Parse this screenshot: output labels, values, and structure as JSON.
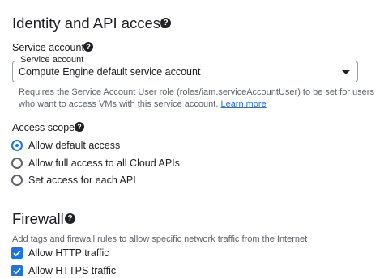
{
  "identity": {
    "title": "Identity and API access",
    "help_glyph": "?",
    "service_accounts": {
      "heading": "Service accounts",
      "help_glyph": "?",
      "select_legend": "Service account",
      "select_value": "Compute Engine default service account",
      "hint_text": "Requires the Service Account User role (roles/iam.serviceAccountUser) to be set for users who want to access VMs with this service account.",
      "learn_more": "Learn more"
    },
    "access_scopes": {
      "heading": "Access scopes",
      "help_glyph": "?",
      "options": [
        {
          "label": "Allow default access",
          "selected": true
        },
        {
          "label": "Allow full access to all Cloud APIs",
          "selected": false
        },
        {
          "label": "Set access for each API",
          "selected": false
        }
      ]
    }
  },
  "firewall": {
    "title": "Firewall",
    "help_glyph": "?",
    "hint_text": "Add tags and firewall rules to allow specific network traffic from the Internet",
    "checkboxes": [
      {
        "label": "Allow HTTP traffic",
        "checked": true
      },
      {
        "label": "Allow HTTPS traffic",
        "checked": true
      }
    ]
  },
  "colors": {
    "accent": "#1a73e8",
    "text": "#202124",
    "secondary_text": "#5f6368",
    "border": "#9aa0a6"
  },
  "icons": {
    "help": "help-circle-icon",
    "dropdown": "caret-down-icon",
    "radio": "radio-icon",
    "checkbox": "checkbox-checked-icon"
  }
}
